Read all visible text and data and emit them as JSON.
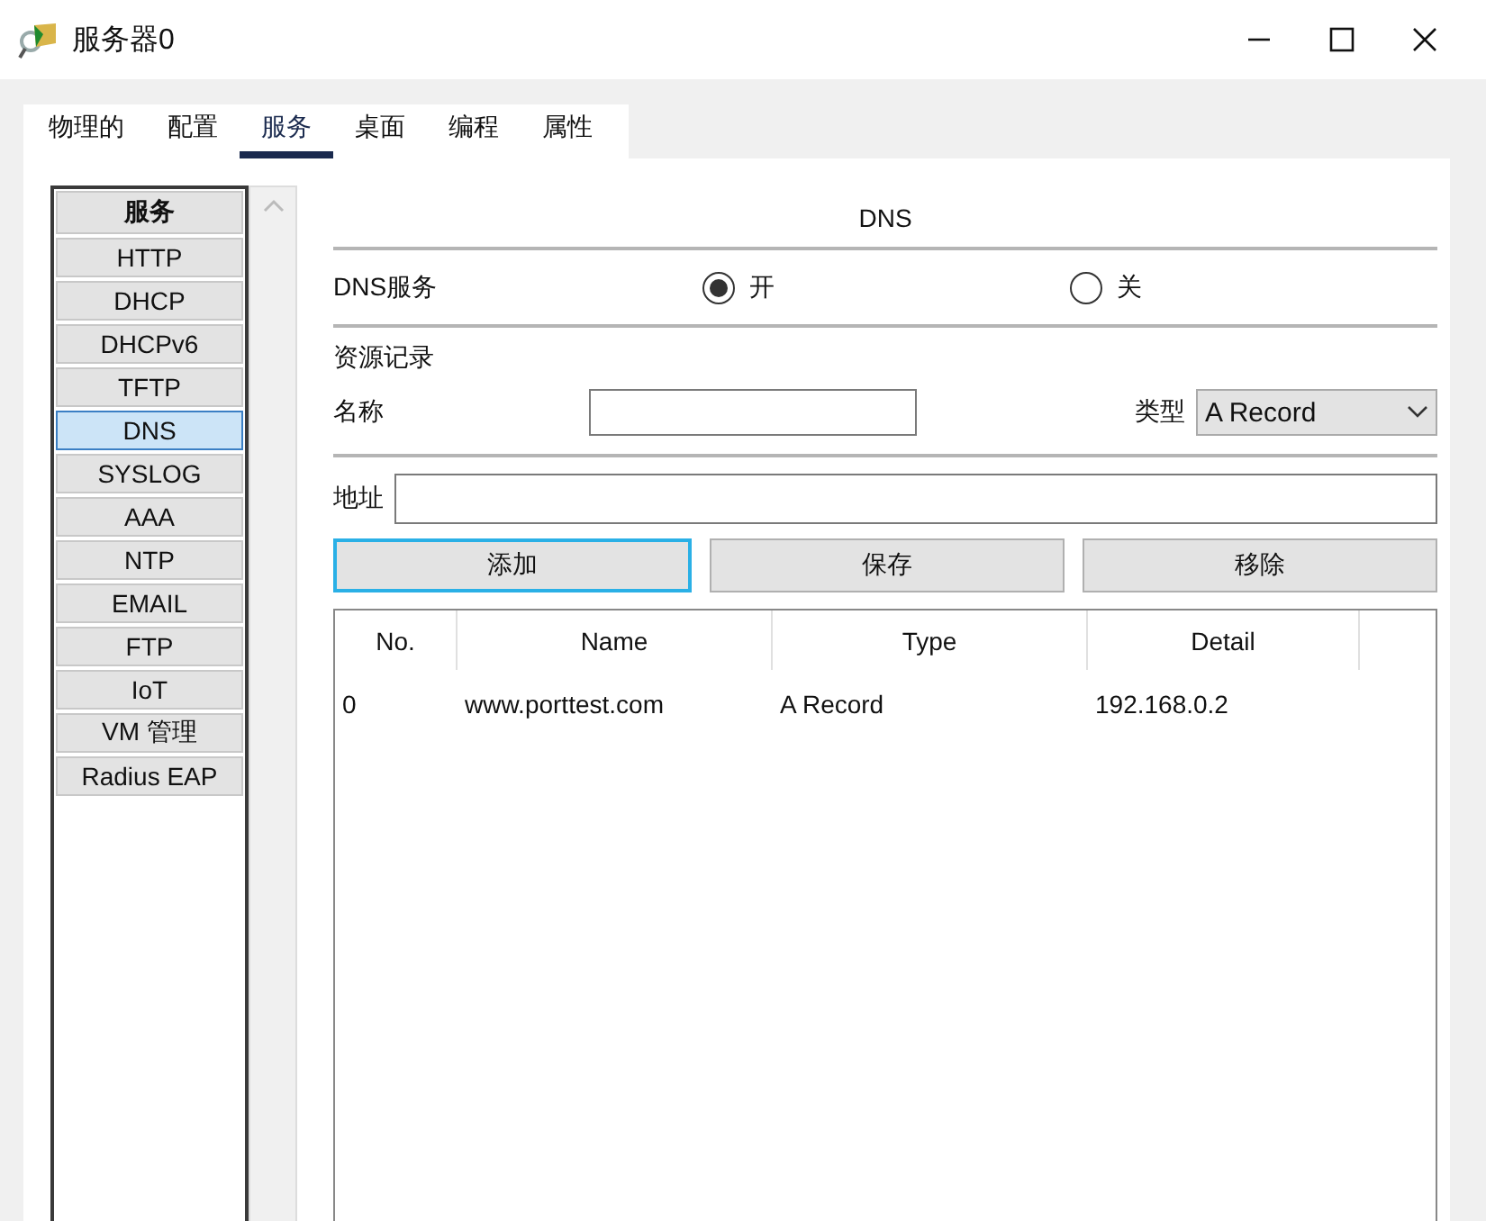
{
  "window": {
    "title": "服务器0"
  },
  "tabs": [
    {
      "label": "物理的",
      "selected": false
    },
    {
      "label": "配置",
      "selected": false
    },
    {
      "label": "服务",
      "selected": true
    },
    {
      "label": "桌面",
      "selected": false
    },
    {
      "label": "编程",
      "selected": false
    },
    {
      "label": "属性",
      "selected": false
    }
  ],
  "sidebar": {
    "header": "服务",
    "items": [
      {
        "label": "HTTP",
        "selected": false
      },
      {
        "label": "DHCP",
        "selected": false
      },
      {
        "label": "DHCPv6",
        "selected": false
      },
      {
        "label": "TFTP",
        "selected": false
      },
      {
        "label": "DNS",
        "selected": true
      },
      {
        "label": "SYSLOG",
        "selected": false
      },
      {
        "label": "AAA",
        "selected": false
      },
      {
        "label": "NTP",
        "selected": false
      },
      {
        "label": "EMAIL",
        "selected": false
      },
      {
        "label": "FTP",
        "selected": false
      },
      {
        "label": "IoT",
        "selected": false
      },
      {
        "label": "VM 管理",
        "selected": false
      },
      {
        "label": "Radius EAP",
        "selected": false
      }
    ]
  },
  "panel": {
    "title": "DNS",
    "service": {
      "label": "DNS服务",
      "options": [
        {
          "label": "开",
          "selected": true
        },
        {
          "label": "关",
          "selected": false
        }
      ]
    },
    "section": "资源记录",
    "name_field": {
      "label": "名称"
    },
    "type_field": {
      "label": "类型",
      "value": "A Record"
    },
    "address_field": {
      "label": "地址"
    },
    "buttons": [
      {
        "label": "添加",
        "focused": true
      },
      {
        "label": "保存",
        "focused": false
      },
      {
        "label": "移除",
        "focused": false
      }
    ]
  },
  "table": {
    "columns": [
      "No.",
      "Name",
      "Type",
      "Detail"
    ],
    "rows": [
      [
        "0",
        "www.porttest.com",
        "A Record",
        "192.168.0.2"
      ]
    ]
  }
}
